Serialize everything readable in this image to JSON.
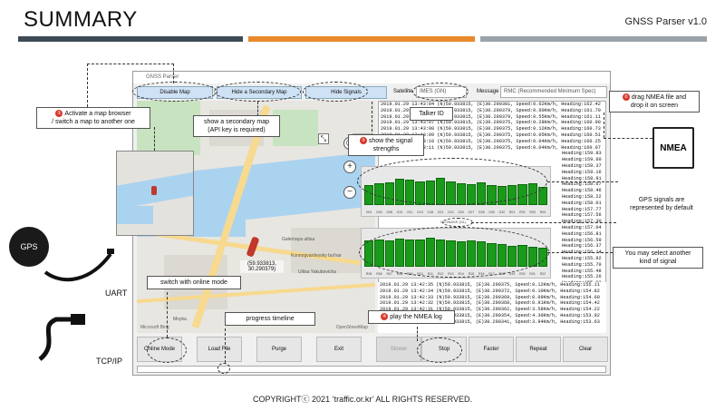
{
  "slide": {
    "title": "SUMMARY",
    "app_name": "GNSS Parser v1.0",
    "copyright": "COPYRIGHTⓒ 2021 ‘traffic.or.kr’ ALL RIGHTS RESERVED."
  },
  "colors": {
    "accent_dark": "#3d4a55",
    "accent_orange": "#e88a2b",
    "accent_gray": "#9aa3aa",
    "signal_green": "#1a9a1a",
    "marker_red": "#d9362b"
  },
  "window": {
    "title": "GNSS Parser"
  },
  "toolbar": {
    "disable_map": "Disable Map",
    "hide_secondary_map": "Hide a Secondary Map",
    "hide_signals": "Hide Signals",
    "satellite_label": "Satellite",
    "satellite_value": "IMES (GN)",
    "message_label": "Message",
    "message_value": "RMC (Recommended Minimum Spec)"
  },
  "map": {
    "coord_text": "(59.933813,\n30.290379)",
    "footer_left": "Microsoft Bing",
    "footer_right": "OpenStreetMap",
    "layer_label": "☰",
    "labels": [
      "Galernaya ulitsa",
      "Konnogvardeysky bul'var",
      "Ulitsa Yakubovicha",
      "Moyka"
    ],
    "zoom_in": "+",
    "zoom_out": "−",
    "target": "◎"
  },
  "log": {
    "top_lines": [
      "2019.01.29 13:43:04 (N)59.933815, (E)30.290381, Speed:0.62Km/h, Heading:162.42",
      "2019.01.29 13:43:05 (N)59.933815, (E)30.290379, Speed:0.60Km/h, Heading:161.70",
      "2019.01.29 13:43:06 (N)59.933815, (E)30.290379, Speed:0.55Km/h, Heading:161.11",
      "2019.01.29 13:43:07 (N)59.933815, (E)30.290375, Speed:0.28Km/h, Heading:160.90",
      "2019.01.29 13:43:08 (N)59.933815, (E)30.290375, Speed:0.12Km/h, Heading:160.73",
      "2019.01.29 13:43:09 (N)59.933815, (E)30.290375, Speed:0.05Km/h, Heading:160.51",
      "2019.01.29 13:43:10 (N)59.933815, (E)30.290375, Speed:0.04Km/h, Heading:160.25",
      "2019.01.29 13:43:11 (N)59.933815, (E)30.290375, Speed:0.04Km/h, Heading:160.07",
      "Heading:159.83",
      "Heading:159.60",
      "Heading:159.37",
      "Heading:159.16",
      "Heading:158.91",
      "Heading:158.67",
      "Heading:158.46",
      "Heading:158.22",
      "Heading:158.01",
      "Heading:157.77",
      "Heading:157.56",
      "Heading:157.30",
      "Heading:157.04",
      "Heading:156.81",
      "Heading:156.59",
      "Heading:156.37",
      "Heading:156.14",
      "Heading:155.92",
      "Heading:155.70",
      "Heading:155.48",
      "Heading:155.26",
      "Heading:155.03"
    ],
    "bottom_lines": [
      "2019.01.29 13:42:35 (N)59.933815, (E)30.290375, Speed:0.12Km/h, Heading:155.11",
      "2019.01.29 13:42:34 (N)59.933815, (E)30.290372, Speed:0.10Km/h, Heading:154.82",
      "2019.01.29 13:42:33 (N)59.933815, (E)30.290369, Speed:0.09Km/h, Heading:154.60",
      "2019.01.29 13:42:32 (N)59.933815, (E)30.290368, Speed:0.91Km/h, Heading:154.42",
      "2019.01.29 13:42:31 (N)59.933815, (E)30.290362, Speed:3.58Km/h, Heading:154.22",
      "2019.01.29 13:42:30 (N)59.933815, (E)30.290354, Speed:4.30Km/h, Heading:153.92",
      "2019.01.29 13:42:29 (N)59.933815, (E)30.290341, Speed:3.94Km/h, Heading:153.63"
    ]
  },
  "signals": {
    "top": {
      "levels": [
        0.55,
        0.6,
        0.62,
        0.72,
        0.7,
        0.66,
        0.68,
        0.74,
        0.66,
        0.6,
        0.58,
        0.62,
        0.56,
        0.52,
        0.56,
        0.58,
        0.6,
        0.5
      ],
      "labels": [
        "G01",
        "G03",
        "G08",
        "G10",
        "G11",
        "G14",
        "G18",
        "G21",
        "G22",
        "G24",
        "G27",
        "G28",
        "G30",
        "G32",
        "R01",
        "R02",
        "R03",
        "R04"
      ]
    },
    "mid_label": "GLONASS (GL)",
    "bottom": {
      "levels": [
        0.72,
        0.74,
        0.72,
        0.78,
        0.76,
        0.76,
        0.8,
        0.74,
        0.72,
        0.7,
        0.72,
        0.7,
        0.66,
        0.62,
        0.58,
        0.6,
        0.56,
        0.52
      ],
      "labels": [
        "R05",
        "R06",
        "R07",
        "R08",
        "R09",
        "R10",
        "R11",
        "R12",
        "R13",
        "R14",
        "R15",
        "R16",
        "R17",
        "R18",
        "R19",
        "R20",
        "R21",
        "R22"
      ]
    }
  },
  "controls": {
    "online_mode": "Online Mode",
    "load_file": "Load File",
    "purge": "Purge",
    "exit": "Exit",
    "slower": "Slower",
    "stop": "Stop",
    "faster": "Faster",
    "repeat": "Repeat",
    "clear": "Clear"
  },
  "callouts": {
    "activate_map_num": "①",
    "activate_map": "Activate a map browser\n/ switch a map to another one",
    "secondary_map": "show a secondary map\n(API key is required)",
    "talker_id": "Talker ID",
    "signal_num": "③",
    "signal_strengths": "show the signal\nstrengths",
    "drag_num": "②",
    "drag_nmea": "drag NMEA file and\ndrop it on screen",
    "nmea": "NMEA",
    "gps_default": "GPS signals are\nrepresented by default",
    "another_signal": "You may select another\nkind of signal",
    "online_mode": "switch with online mode",
    "progress": "progress timeline",
    "play_num": "④",
    "play_log": "play the NMEA log"
  },
  "side": {
    "gps": "GPS",
    "uart": "UART",
    "tcpip": "TCP/IP"
  }
}
